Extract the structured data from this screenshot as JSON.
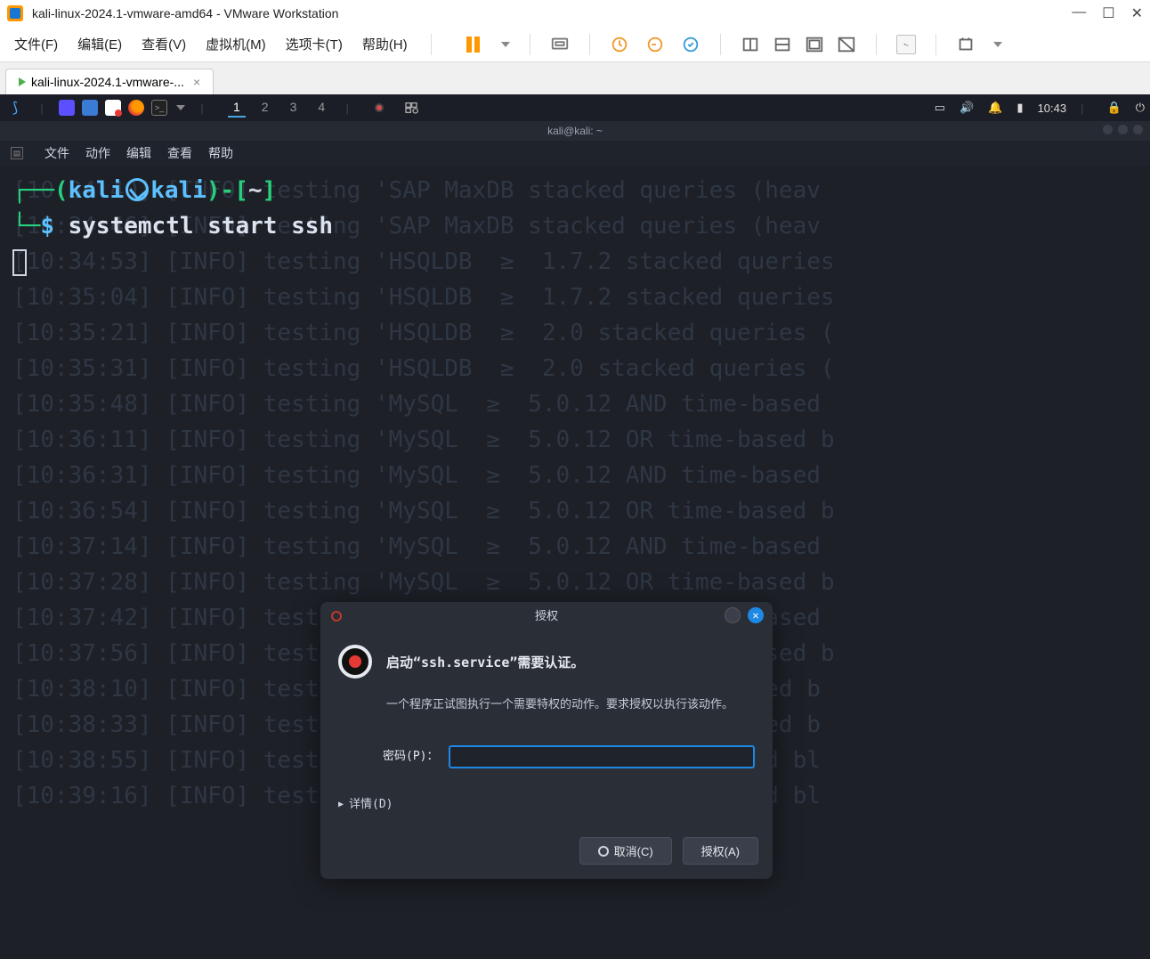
{
  "vmware": {
    "window_title": "kali-linux-2024.1-vmware-amd64 - VMware Workstation",
    "menu": {
      "file": "文件(F)",
      "edit": "编辑(E)",
      "view": "查看(V)",
      "vm": "虚拟机(M)",
      "tabs": "选项卡(T)",
      "help": "帮助(H)"
    },
    "tab_label": "kali-linux-2024.1-vmware-..."
  },
  "kali_bar": {
    "workspaces": [
      "1",
      "2",
      "3",
      "4"
    ],
    "active_workspace": "1",
    "clock": "10:43",
    "term_glyph": ">_"
  },
  "terminal_window": {
    "title": "kali@kali: ~",
    "menu": {
      "file": "文件",
      "action": "动作",
      "edit": "编辑",
      "view": "查看",
      "help": "帮助"
    }
  },
  "prompt": {
    "user": "kali",
    "host": "kali",
    "cwd": "~",
    "dollar": "$",
    "command": "systemctl start ssh"
  },
  "ghost_output": [
    "[10:34:40] [INFO] testing 'SAP MaxDB stacked queries (heav",
    "[10:34:46] [INFO] testing 'SAP MaxDB stacked queries (heav",
    "[10:34:53] [INFO] testing 'HSQLDB  ≥  1.7.2 stacked queries",
    "[10:35:04] [INFO] testing 'HSQLDB  ≥  1.7.2 stacked queries",
    "[10:35:21] [INFO] testing 'HSQLDB  ≥  2.0 stacked queries (",
    "[10:35:31] [INFO] testing 'HSQLDB  ≥  2.0 stacked queries (",
    "[10:35:48] [INFO] testing 'MySQL  ≥  5.0.12 AND time-based ",
    "[10:36:11] [INFO] testing 'MySQL  ≥  5.0.12 OR time-based b",
    "[10:36:31] [INFO] testing 'MySQL  ≥  5.0.12 AND time-based ",
    "[10:36:54] [INFO] testing 'MySQL  ≥  5.0.12 OR time-based b",
    "[10:37:14] [INFO] testing 'MySQL  ≥  5.0.12 AND time-based ",
    "[10:37:28] [INFO] testing 'MySQL  ≥  5.0.12 OR time-based b",
    "[10:37:42] [INFO] testing 'MySQL  ≥  5.0.12 AND time-based ",
    "[10:37:56] [INFO] testing 'MySQL  ≥  5.0.12 OR time-based b",
    "[10:38:10] [INFO] testing 'MySQL < 5.0.12 AND time-based b",
    "[10:38:33] [INFO] testing 'MySQL > 5.0.12 AND time-based b",
    "[10:38:55] [INFO] testing 'MySQL < 5.0.12 OR time-based bl",
    "[10:39:16] [INFO] testing 'MySQL > 5.0.12 OR time-based bl"
  ],
  "auth_dialog": {
    "title": "授权",
    "heading": "启动“ssh.service”需要认证。",
    "message": "一个程序正试图执行一个需要特权的动作。要求授权以执行该动作。",
    "password_label": "密码(P)：",
    "details_label": "详情(D)",
    "cancel": "取消(C)",
    "authorize": "授权(A)",
    "close_glyph": "✕"
  }
}
